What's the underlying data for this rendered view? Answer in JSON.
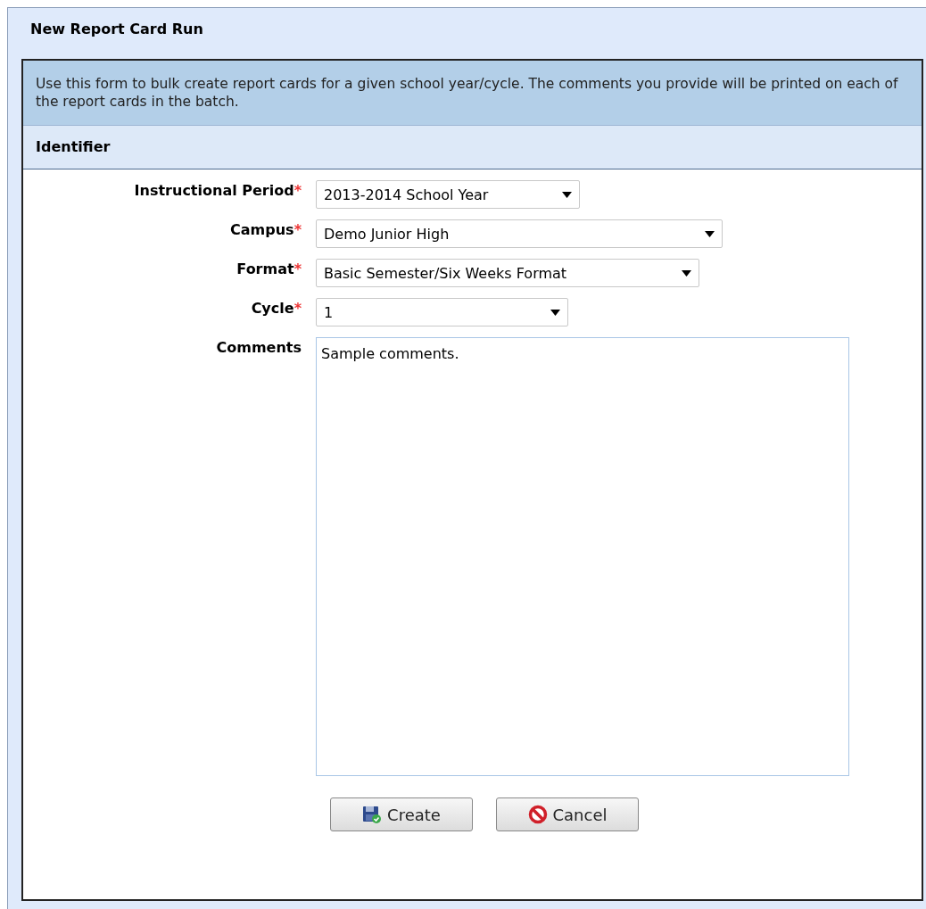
{
  "panel": {
    "title": "New Report Card Run"
  },
  "description": "Use this form to bulk create report cards for a given school year/cycle. The comments you provide will be printed on each of the report cards in the batch.",
  "section": {
    "title": "Identifier"
  },
  "fields": [
    {
      "label": "Instructional Period",
      "required_mark": "*",
      "kind": "select",
      "value": "2013-2014 School Year"
    },
    {
      "label": "Campus",
      "required_mark": "*",
      "kind": "select",
      "value": "Demo Junior High"
    },
    {
      "label": "Format",
      "required_mark": "*",
      "kind": "select",
      "value": "Basic Semester/Six Weeks Format"
    },
    {
      "label": "Cycle",
      "required_mark": "*",
      "kind": "select",
      "value": "1"
    },
    {
      "label": "Comments",
      "kind": "textarea",
      "value": "Sample comments."
    }
  ],
  "buttons": [
    {
      "label": "Create",
      "kind": "create"
    },
    {
      "label": "Cancel",
      "kind": "cancel"
    }
  ]
}
